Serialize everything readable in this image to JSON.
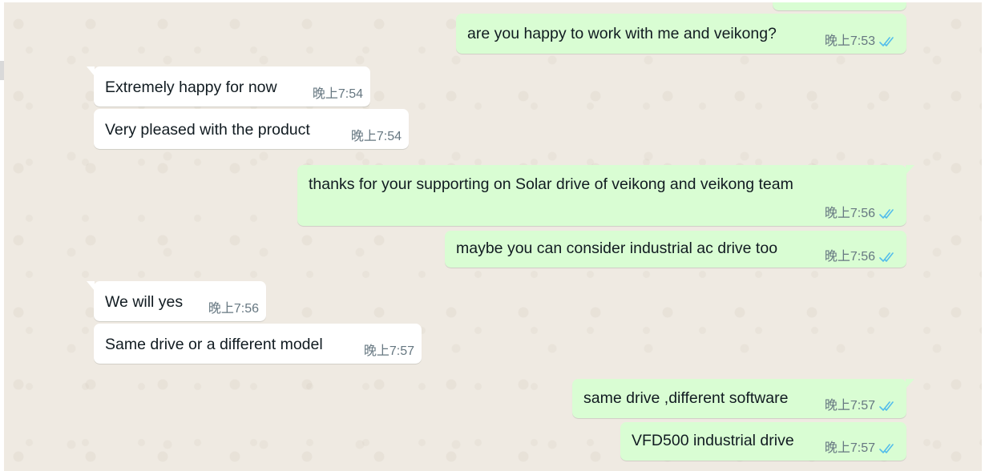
{
  "colors": {
    "chat_background": "#efeae2",
    "incoming_bubble": "#ffffff",
    "outgoing_bubble": "#d9fdd3",
    "timestamp": "#667781",
    "read_ticks": "#53bdeb"
  },
  "messages": [
    {
      "direction": "outgoing",
      "text": "are you happy to work with me and veikong?",
      "time": "晚上7:53",
      "status_icon": "double-check-read-icon"
    },
    {
      "direction": "incoming",
      "text": "Extremely happy for now",
      "time": "晚上7:54"
    },
    {
      "direction": "incoming",
      "text": "Very pleased with the product",
      "time": "晚上7:54"
    },
    {
      "direction": "outgoing",
      "text": "thanks for your supporting on Solar drive of veikong and veikong team",
      "time": "晚上7:56",
      "status_icon": "double-check-read-icon"
    },
    {
      "direction": "outgoing",
      "text": "maybe you can consider industrial ac drive too",
      "time": "晚上7:56",
      "status_icon": "double-check-read-icon"
    },
    {
      "direction": "incoming",
      "text": "We will yes",
      "time": "晚上7:56"
    },
    {
      "direction": "incoming",
      "text": "Same drive or a different model",
      "time": "晚上7:57"
    },
    {
      "direction": "outgoing",
      "text": "same drive ,different software",
      "time": "晚上7:57",
      "status_icon": "double-check-read-icon"
    },
    {
      "direction": "outgoing",
      "text": "VFD500 industrial drive",
      "time": "晚上7:57",
      "status_icon": "double-check-read-icon"
    }
  ]
}
